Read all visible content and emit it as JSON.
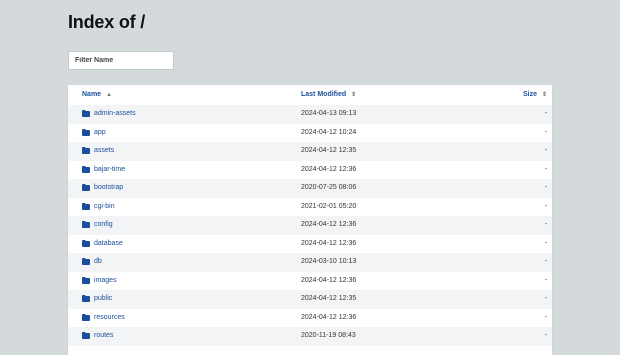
{
  "page": {
    "title": "Index of /"
  },
  "filter": {
    "placeholder": "Filter Name"
  },
  "table": {
    "headers": {
      "name": "Name",
      "modified": "Last Modified",
      "size": "Size"
    },
    "rows": [
      {
        "name": "admin-assets",
        "modified": "2024-04-13 09:13",
        "size": "-"
      },
      {
        "name": "app",
        "modified": "2024-04-12 10:24",
        "size": "-"
      },
      {
        "name": "assets",
        "modified": "2024-04-12 12:35",
        "size": "-"
      },
      {
        "name": "bajar-time",
        "modified": "2024-04-12 12:36",
        "size": "-"
      },
      {
        "name": "bootstrap",
        "modified": "2020-07-25 08:06",
        "size": "-"
      },
      {
        "name": "cgi-bin",
        "modified": "2021-02-01 05:20",
        "size": "-"
      },
      {
        "name": "config",
        "modified": "2024-04-12 12:36",
        "size": "-"
      },
      {
        "name": "database",
        "modified": "2024-04-12 12:36",
        "size": "-"
      },
      {
        "name": "db",
        "modified": "2024-03-10 10:13",
        "size": "-"
      },
      {
        "name": "images",
        "modified": "2024-04-12 12:36",
        "size": "-"
      },
      {
        "name": "public",
        "modified": "2024-04-12 12:35",
        "size": "-"
      },
      {
        "name": "resources",
        "modified": "2024-04-12 12:36",
        "size": "-"
      },
      {
        "name": "routes",
        "modified": "2020-11-19 08:43",
        "size": "-"
      }
    ]
  },
  "colors": {
    "link": "#1b4f9c",
    "folder_icon": "#1b4f9c",
    "background": "#d4d9dc"
  }
}
